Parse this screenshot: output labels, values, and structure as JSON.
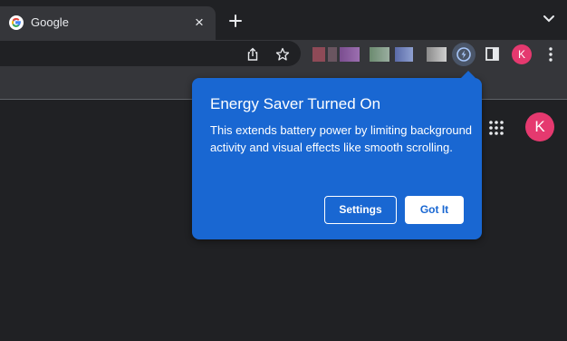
{
  "tab": {
    "title": "Google"
  },
  "toolbar": {
    "profile_initial": "K"
  },
  "page": {
    "profile_initial": "K"
  },
  "energy_saver_bubble": {
    "title": "Energy Saver Turned On",
    "body": "This extends battery power by limiting background activity and visual effects like smooth scrolling.",
    "settings_label": "Settings",
    "got_it_label": "Got It"
  },
  "icons": [
    "google-favicon",
    "close-icon",
    "new-tab-icon",
    "tab-search-icon",
    "share-icon",
    "bookmark-star-icon",
    "energy-saver-icon",
    "side-panel-icon",
    "kebab-menu-icon",
    "apps-grid-icon"
  ],
  "colors": {
    "bubble": "#1967d2",
    "avatar": "#e5396f",
    "background": "#202124",
    "toolbar": "#35363a"
  }
}
